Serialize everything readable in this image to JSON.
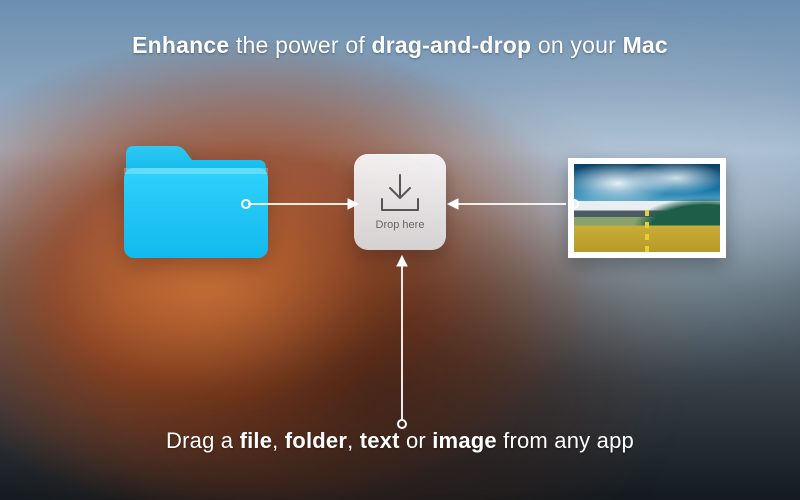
{
  "headline": {
    "w1": "Enhance",
    "w2": " the power of ",
    "w3": "drag-and-drop",
    "w4": " on your ",
    "w5": "Mac"
  },
  "drop": {
    "label": "Drop here"
  },
  "footline": {
    "t1": "Drag a ",
    "t2": "file",
    "t3": ", ",
    "t4": "folder",
    "t5": ", ",
    "t6": "text",
    "t7": " or ",
    "t8": "image",
    "t9": " from any app"
  },
  "icons": {
    "folder": "folder-icon",
    "download": "download-tray-icon",
    "photo": "landscape-photo"
  }
}
